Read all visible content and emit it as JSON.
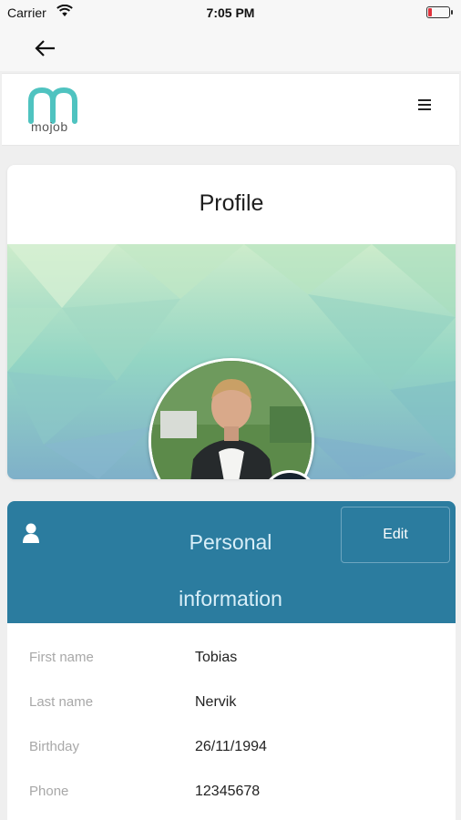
{
  "status_bar": {
    "carrier": "Carrier",
    "time": "7:05 PM"
  },
  "app": {
    "logo_text": "mojob"
  },
  "profile": {
    "title": "Profile"
  },
  "personal_info": {
    "title": "Personal information",
    "edit_label": "Edit",
    "fields": [
      {
        "label": "First name",
        "value": "Tobias"
      },
      {
        "label": "Last name",
        "value": "Nervik"
      },
      {
        "label": "Birthday",
        "value": "26/11/1994"
      },
      {
        "label": "Phone",
        "value": "12345678"
      }
    ]
  },
  "colors": {
    "brand_teal": "#4fc3c0",
    "header_blue": "#2b7c9f",
    "add_button_dark": "#16222e",
    "battery_low": "#e0323c"
  },
  "icons": [
    "wifi-icon",
    "battery-icon",
    "back-arrow-icon",
    "hamburger-menu-icon",
    "plus-icon",
    "user-icon"
  ]
}
